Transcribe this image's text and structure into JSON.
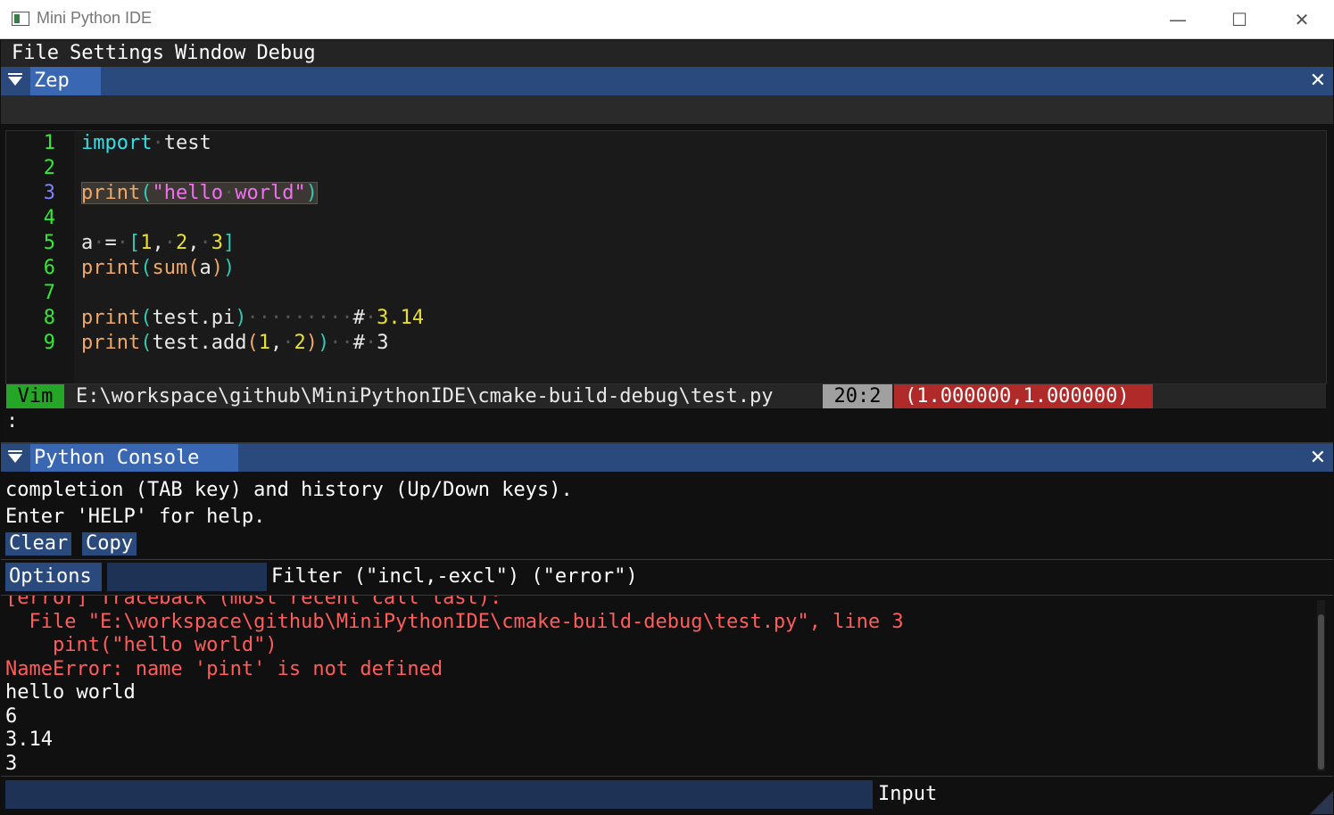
{
  "window": {
    "title": "Mini Python IDE",
    "controls": {
      "minimize": "—",
      "maximize": "☐",
      "close": "✕"
    }
  },
  "menu": [
    "File",
    "Settings",
    "Window",
    "Debug"
  ],
  "editor_panel": {
    "tab_label": "Zep",
    "close": "✕",
    "lines": [
      {
        "num": "1",
        "parts": [
          {
            "t": "import",
            "c": "kw"
          },
          {
            "t": "·",
            "c": "ws"
          },
          {
            "t": "test",
            "c": ""
          }
        ]
      },
      {
        "num": "2",
        "parts": []
      },
      {
        "num": "3",
        "current": true,
        "parts": [
          {
            "t": "print",
            "c": "fn"
          },
          {
            "t": "(",
            "c": "par"
          },
          {
            "t": "\"hello",
            "c": "str"
          },
          {
            "t": "·",
            "c": "ws"
          },
          {
            "t": "world\"",
            "c": "str"
          },
          {
            "t": ")",
            "c": "par"
          }
        ]
      },
      {
        "num": "4",
        "parts": []
      },
      {
        "num": "5",
        "parts": [
          {
            "t": "a",
            "c": ""
          },
          {
            "t": "·",
            "c": "ws"
          },
          {
            "t": "=",
            "c": ""
          },
          {
            "t": "·",
            "c": "ws"
          },
          {
            "t": "[",
            "c": "par"
          },
          {
            "t": "1",
            "c": "num"
          },
          {
            "t": ",",
            "c": ""
          },
          {
            "t": "·",
            "c": "ws"
          },
          {
            "t": "2",
            "c": "num"
          },
          {
            "t": ",",
            "c": ""
          },
          {
            "t": "·",
            "c": "ws"
          },
          {
            "t": "3",
            "c": "num"
          },
          {
            "t": "]",
            "c": "par"
          }
        ]
      },
      {
        "num": "6",
        "parts": [
          {
            "t": "print",
            "c": "fn"
          },
          {
            "t": "(",
            "c": "par"
          },
          {
            "t": "sum",
            "c": "fn"
          },
          {
            "t": "(",
            "c": "fn"
          },
          {
            "t": "a",
            "c": ""
          },
          {
            "t": ")",
            "c": "fn"
          },
          {
            "t": ")",
            "c": "par"
          }
        ]
      },
      {
        "num": "7",
        "parts": []
      },
      {
        "num": "8",
        "parts": [
          {
            "t": "print",
            "c": "fn"
          },
          {
            "t": "(",
            "c": "par"
          },
          {
            "t": "test.pi",
            "c": ""
          },
          {
            "t": ")",
            "c": "par"
          },
          {
            "t": "·········",
            "c": "ws"
          },
          {
            "t": "#",
            "c": ""
          },
          {
            "t": "·",
            "c": "ws"
          },
          {
            "t": "3.14",
            "c": "num"
          }
        ]
      },
      {
        "num": "9",
        "parts": [
          {
            "t": "print",
            "c": "fn"
          },
          {
            "t": "(",
            "c": "par"
          },
          {
            "t": "test.add",
            "c": ""
          },
          {
            "t": "(",
            "c": "fn"
          },
          {
            "t": "1",
            "c": "num"
          },
          {
            "t": ",",
            "c": ""
          },
          {
            "t": "·",
            "c": "ws"
          },
          {
            "t": "2",
            "c": "num"
          },
          {
            "t": ")",
            "c": "fn"
          },
          {
            "t": ")",
            "c": "par"
          },
          {
            "t": "··",
            "c": "ws"
          },
          {
            "t": "#",
            "c": ""
          },
          {
            "t": "·",
            "c": "ws"
          },
          {
            "t": "3",
            "c": ""
          }
        ]
      }
    ],
    "status": {
      "mode": "Vim",
      "file_path": "E:\\workspace\\github\\MiniPythonIDE\\cmake-build-debug\\test.py",
      "cursor_pos": "20:2",
      "mouse_info": "(1.000000,1.000000)"
    },
    "command_line": ":"
  },
  "console_panel": {
    "tab_label": "Python Console",
    "close": "✕",
    "intro_lines": [
      "completion (TAB key) and history (Up/Down keys).",
      "Enter 'HELP' for help."
    ],
    "buttons": {
      "clear": "Clear",
      "copy": "Copy"
    },
    "options_label": "Options",
    "filter_label": "Filter (\"incl,-excl\") (\"error\")",
    "log": [
      {
        "text": "[error] Traceback (most recent call last):",
        "type": "err"
      },
      {
        "text": "  File \"E:\\workspace\\github\\MiniPythonIDE\\cmake-build-debug\\test.py\", line 3",
        "type": "err"
      },
      {
        "text": "    pint(\"hello world\")",
        "type": "err"
      },
      {
        "text": "NameError: name 'pint' is not defined",
        "type": "err"
      },
      {
        "text": "hello world",
        "type": "out"
      },
      {
        "text": "6",
        "type": "out"
      },
      {
        "text": "3.14",
        "type": "out"
      },
      {
        "text": "3",
        "type": "out"
      }
    ],
    "input_label": "Input"
  }
}
